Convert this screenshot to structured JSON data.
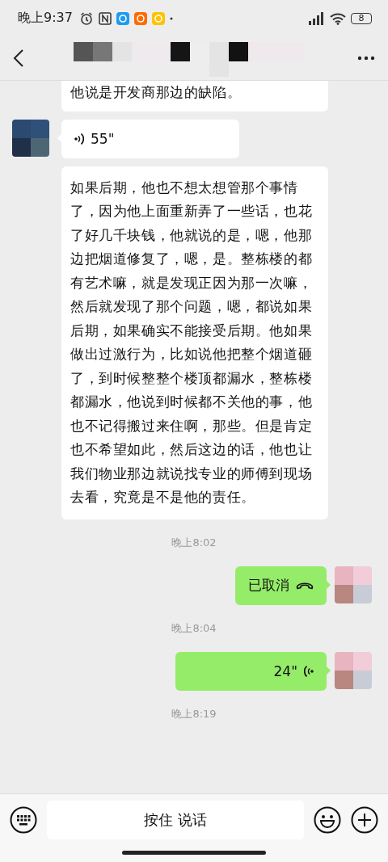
{
  "status_bar": {
    "time": "晚上9:37",
    "battery": "8"
  },
  "messages": [
    {
      "kind": "text",
      "outgoing": false,
      "avatar": false,
      "cut_top": true,
      "text": "他说是开发商那边的缺陷。"
    },
    {
      "kind": "voice",
      "outgoing": false,
      "avatar": true,
      "duration": "55\""
    },
    {
      "kind": "text",
      "outgoing": false,
      "avatar": false,
      "cut_top": false,
      "text": "如果后期，他也不想太想管那个事情了，因为他上面重新弄了一些话，也花了好几千块钱，他就说的是，嗯，他那边把烟道修复了，嗯，是。整栋楼的都有艺术嘛，就是发现正因为那一次嘛，然后就发现了那个问题，嗯，都说如果后期，如果确实不能接受后期。他如果做出过激行为，比如说他把整个烟道砸了，到时候整整个楼顶都漏水，整栋楼都漏水，他说到时候都不关他的事，他也不记得搬过来住啊，那些。但是肯定也不希望如此，然后这边的话，他也让我们物业那边就说找专业的师傅到现场去看，究竟是不是他的责任。"
    },
    {
      "kind": "time",
      "text": "晚上8:02"
    },
    {
      "kind": "call",
      "outgoing": true,
      "avatar": true,
      "label": "已取消"
    },
    {
      "kind": "time",
      "text": "晚上8:04"
    },
    {
      "kind": "voice",
      "outgoing": true,
      "avatar": true,
      "duration": "24\""
    },
    {
      "kind": "time",
      "text": "晚上8:19"
    }
  ],
  "input_bar": {
    "hold_button": "按住 说话"
  }
}
